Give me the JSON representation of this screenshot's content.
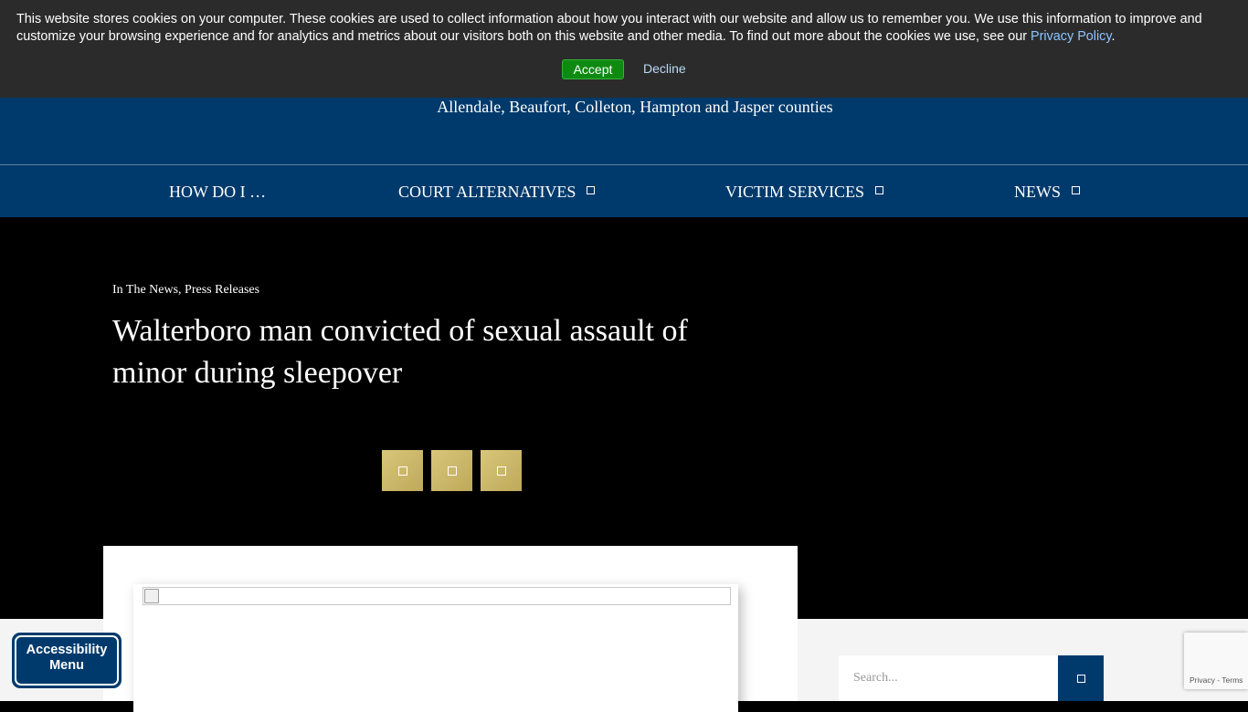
{
  "cookie_banner": {
    "message": "This website stores cookies on your computer. These cookies are used to collect information about how you interact with our website and allow us to remember you. We use this information to improve and customize your browsing experience and for analytics and metrics about our visitors both on this website and other media. To find out more about the cookies we use, see our",
    "policy_link": "Privacy Policy",
    "period": ".",
    "accept_label": "Accept",
    "decline_label": "Decline",
    "accept_color": "#0f8a11"
  },
  "header": {
    "counties": "Allendale, Beaufort, Colleton, Hampton and Jasper counties",
    "brand_color": "#003a6c"
  },
  "nav": {
    "items": [
      {
        "label": "HOW DO I …",
        "has_dropdown": false
      },
      {
        "label": "COURT ALTERNATIVES",
        "has_dropdown": true
      },
      {
        "label": "VICTIM SERVICES",
        "has_dropdown": true
      },
      {
        "label": "NEWS",
        "has_dropdown": true
      }
    ]
  },
  "article": {
    "categories": "In The News, Press Releases",
    "title": "Walterboro man convicted of sexual assault of minor during sleepover",
    "share_buttons": [
      "share-icon",
      "share-icon",
      "share-icon"
    ],
    "accent_color": "#c9b468"
  },
  "sidebar": {
    "search_placeholder": "Search..."
  },
  "accessibility": {
    "label_line1": "Accessibility",
    "label_line2": "Menu"
  },
  "recaptcha": {
    "privacy": "Privacy",
    "separator": " - ",
    "terms": "Terms"
  }
}
